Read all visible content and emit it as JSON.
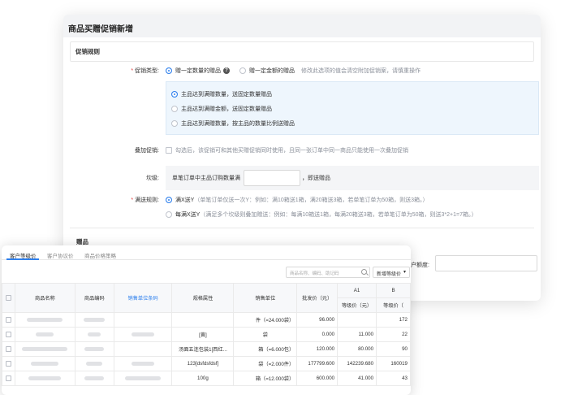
{
  "form": {
    "title": "商品买赠促销新增",
    "section_rules": "促销规则",
    "promo_type": {
      "label": "促销类型:",
      "opt1": "赠一定数量的赠品",
      "opt2": "赠一定金额的赠品",
      "hint": "修改此选项的值会清空附加促销案，请慎重操作",
      "sub1": "主品达到满赠数量，送固定数量赠品",
      "sub2": "主品达到满赠金额，送固定数量赠品",
      "sub3": "主品达到满赠数量，按主品的数量比例送赠品"
    },
    "stack": {
      "label": "叠加促销:",
      "desc": "勾选后，该促销可和其他买赠促销同时使用，且同一张订单中同一商品只能使用一次叠加促销"
    },
    "tier": {
      "label": "坎级:",
      "pre": "单笔订单中主品订购数量满",
      "post": "，即送赠品"
    },
    "rule": {
      "label": "满送规则:",
      "opt1": "满X送Y",
      "opt1_desc": "（单笔订单仅送一次Y：例如：满10箱送1箱，满20箱送3箱，若单笔订单为50箱，则送3箱。）",
      "opt2": "每满X送Y",
      "opt2_desc": "（满足多个坎级则叠加赠送：例如：每满10箱送1箱，每满20箱送3箱，若单笔订单为50箱，则送3*2+1=7箱。）"
    },
    "section_gift": "赠品",
    "quota_label": "户额度:"
  },
  "card": {
    "tabs": [
      "客户等级价",
      "客户协议价",
      "商品价格策略"
    ],
    "search_placeholder": "商品名称、编码、助记码",
    "level_button": "新增等级价",
    "headers": {
      "name": "商品名称",
      "code": "商品编码",
      "barcode": "销售单位条码",
      "spec": "规格属性",
      "unit": "销售单位",
      "wholesale": "批发价（元）",
      "a1": "A1",
      "a1_sub": "等级价（元）",
      "b": "B",
      "b_sub": "等级价（"
    },
    "rows": [
      {
        "spec": "",
        "unit": "件（=24.000袋）",
        "wholesale": "96.000",
        "a1": "",
        "b": "172"
      },
      {
        "spec": "[黄]",
        "unit": "袋",
        "wholesale": "0.000",
        "a1": "11.000",
        "b": "22"
      },
      {
        "spec": "汤面五连包装1[西红...",
        "unit": "箱（=6.000包）",
        "wholesale": "120.000",
        "a1": "80.000",
        "b": "90"
      },
      {
        "spec": "123[dsfdsfdsf]",
        "unit": "袋（=2.000件）",
        "wholesale": "177799.600",
        "a1": "142239.680",
        "b": "160019"
      },
      {
        "spec": "100g",
        "unit": "箱（=12.000袋）",
        "wholesale": "600.000",
        "a1": "41.000",
        "b": "43"
      }
    ]
  },
  "colors": {
    "accent": "#2f80ed",
    "required": "#e23c3c",
    "subbox_bg": "#eef6fd"
  },
  "icons": [
    "help-icon",
    "search-icon",
    "chevron-down-icon"
  ]
}
